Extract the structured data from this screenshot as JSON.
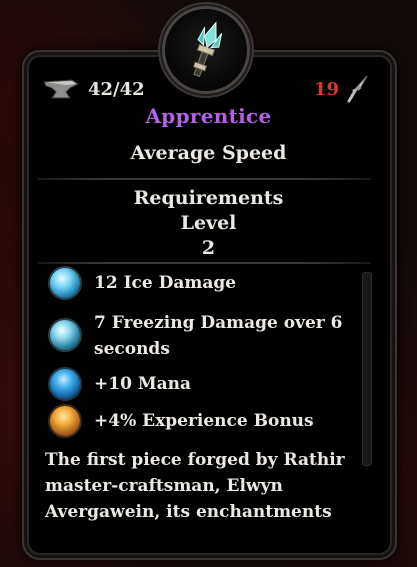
{
  "item": {
    "durability": "42/42",
    "price": "19",
    "rarity": "Apprentice",
    "speed": "Average Speed",
    "requirements_title": "Requirements",
    "requirements_type": "Level",
    "requirements_value": "2",
    "stats": [
      {
        "icon": "ice-orb-icon",
        "text": "12 Ice Damage"
      },
      {
        "icon": "freeze-orb-icon",
        "text": "7 Freezing Damage over 6 seconds"
      },
      {
        "icon": "mana-orb-icon",
        "text": "+10 Mana"
      },
      {
        "icon": "experience-orb-icon",
        "text": "+4% Experience Bonus"
      }
    ],
    "description": "The first piece forged by Rathir master-craftsman, Elwyn Avergawein, its enchantments"
  },
  "colors": {
    "rarity": "#b261e8",
    "price": "#d9372d",
    "text": "#ece8e3"
  }
}
